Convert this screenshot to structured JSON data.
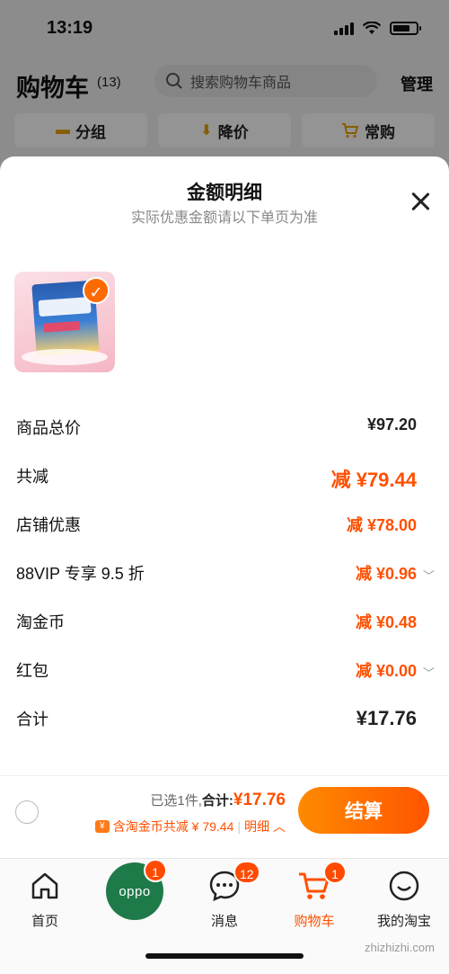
{
  "status_bar": {
    "time": "13:19"
  },
  "cart_header": {
    "title": "购物车",
    "count": "(13)",
    "search_placeholder": "搜索购物车商品",
    "manage_label": "管理"
  },
  "filters": [
    {
      "label": "分组",
      "icon": "folder-icon"
    },
    {
      "label": "降价",
      "icon": "price-drop-icon"
    },
    {
      "label": "常购",
      "icon": "cart-icon"
    }
  ],
  "sheet": {
    "title": "金额明细",
    "subtitle": "实际优惠金额请以下单页为准",
    "rows": [
      {
        "label": "商品总价",
        "value": "¥97.20",
        "color": "black",
        "chevron": false
      },
      {
        "label": "共减",
        "value": "减 ¥79.44",
        "color": "orange",
        "chevron": false
      },
      {
        "label": "店铺优惠",
        "value": "减 ¥78.00",
        "color": "orange",
        "chevron": false
      },
      {
        "label": "88VIP 专享 9.5 折",
        "value": "减 ¥0.96",
        "color": "orange",
        "chevron": true
      },
      {
        "label": "淘金币",
        "value": "减 ¥0.48",
        "color": "orange",
        "chevron": false
      },
      {
        "label": "红包",
        "value": "减 ¥0.00",
        "color": "orange",
        "chevron": true
      },
      {
        "label": "合计",
        "value": "¥17.76",
        "color": "black",
        "chevron": false
      }
    ]
  },
  "checkout": {
    "selected_text": "已选1件,",
    "total_label": "合计:",
    "total_value": "¥17.76",
    "coin_text": "含淘金币共减 ¥ 79.44",
    "detail_label": "明细",
    "button_label": "结算"
  },
  "tabbar": {
    "tabs": [
      {
        "label": "首页",
        "icon": "home-icon",
        "badge": ""
      },
      {
        "label": "",
        "icon": "oppo-bubble",
        "badge": "1"
      },
      {
        "label": "消息",
        "icon": "message-icon",
        "badge": "12"
      },
      {
        "label": "购物车",
        "icon": "cart-icon",
        "badge": "1"
      },
      {
        "label": "我的淘宝",
        "icon": "profile-icon",
        "badge": ""
      }
    ],
    "oppo_text": "oppo"
  },
  "watermark": "zhizhizhi.com",
  "colors": {
    "accent": "#ff5000",
    "button_start": "#ff8a00",
    "button_end": "#ff5500"
  }
}
